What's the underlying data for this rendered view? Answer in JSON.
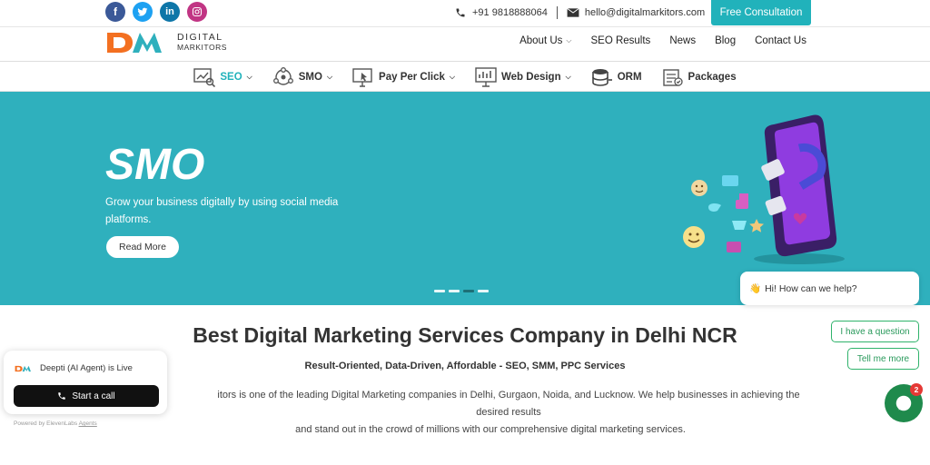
{
  "topbar": {
    "social": [
      "facebook-icon",
      "twitter-icon",
      "linkedin-icon",
      "instagram-icon"
    ],
    "phone": "+91 9818888064",
    "email": "hello@digitalmarkitors.com",
    "cta": "Free Consultation"
  },
  "brand": {
    "line1": "DIGITAL",
    "line2": "MARKITORS",
    "logo_mark": "DM"
  },
  "mainnav": [
    {
      "label": "About Us",
      "has_caret": true
    },
    {
      "label": "SEO Results"
    },
    {
      "label": "News"
    },
    {
      "label": "Blog"
    },
    {
      "label": "Contact Us"
    }
  ],
  "servicenav": [
    {
      "label": "SEO",
      "icon": "seo-icon",
      "active": true
    },
    {
      "label": "SMO",
      "icon": "smo-icon"
    },
    {
      "label": "Pay Per Click",
      "icon": "ppc-icon"
    },
    {
      "label": "Web Design",
      "icon": "web-design-icon"
    },
    {
      "label": "ORM",
      "icon": "orm-icon"
    },
    {
      "label": "Packages",
      "icon": "packages-icon"
    }
  ],
  "hero": {
    "title": "SMO",
    "subtitle": "Grow your business digitally by using social media platforms.",
    "button": "Read More",
    "active_slide": 3,
    "slide_count": 4
  },
  "main": {
    "heading": "Best Digital Marketing Services Company in Delhi NCR",
    "subheading": "Result-Oriented, Data-Driven, Affordable - SEO, SMM, PPC Services",
    "paragraph_line1": "itors is one of the leading Digital Marketing companies in Delhi, Gurgaon, Noida, and Lucknow. We help businesses in achieving the desired results",
    "paragraph_line2": "and stand out in the crowd of millions with our comprehensive digital marketing services."
  },
  "ai_widget": {
    "status": "Deepti (AI Agent) is Live",
    "button": "Start a call",
    "powered_prefix": "Powered by ElevenLabs",
    "powered_link": "Agents"
  },
  "chat": {
    "greeting": "Hi! How can we help?",
    "option1": "I have a question",
    "option2": "Tell me more",
    "badge_count": "2"
  },
  "colors": {
    "accent": "#21b2bb",
    "hero_bg": "#2fb0bd",
    "chat_green": "#1f8a4c"
  }
}
